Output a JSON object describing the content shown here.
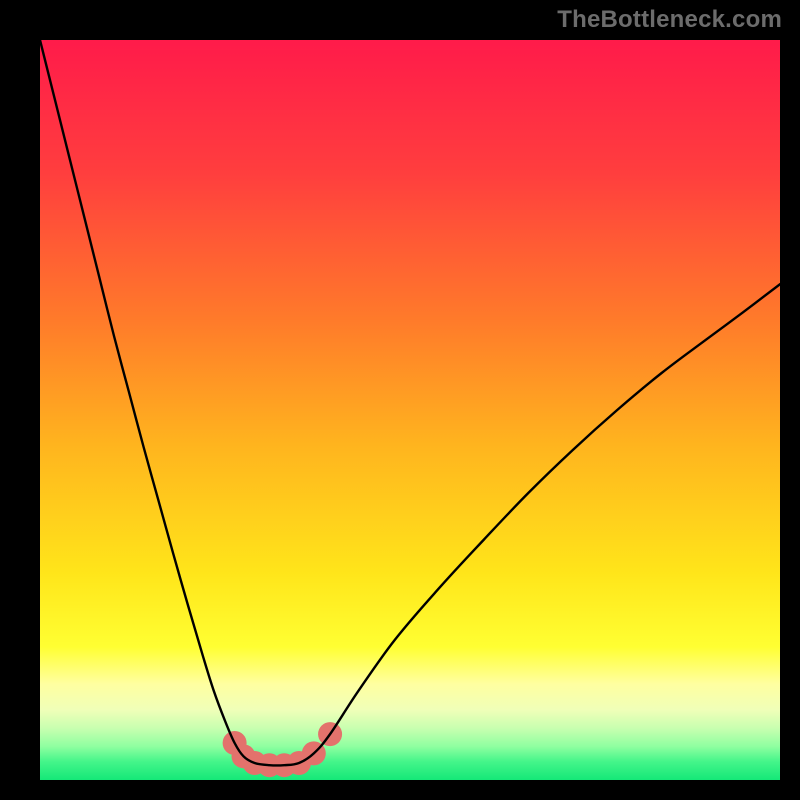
{
  "watermark": "TheBottleneck.com",
  "chart_data": {
    "type": "line",
    "title": "",
    "xlabel": "",
    "ylabel": "",
    "xlim": [
      0,
      100
    ],
    "ylim": [
      0,
      100
    ],
    "background_gradient_stops": [
      {
        "offset": 0.0,
        "color": "#ff1b4a"
      },
      {
        "offset": 0.18,
        "color": "#ff3e3e"
      },
      {
        "offset": 0.38,
        "color": "#ff7b2a"
      },
      {
        "offset": 0.55,
        "color": "#ffb51e"
      },
      {
        "offset": 0.72,
        "color": "#ffe51a"
      },
      {
        "offset": 0.82,
        "color": "#ffff32"
      },
      {
        "offset": 0.87,
        "color": "#ffffa0"
      },
      {
        "offset": 0.905,
        "color": "#f0ffb8"
      },
      {
        "offset": 0.93,
        "color": "#c8ffb0"
      },
      {
        "offset": 0.955,
        "color": "#8effa0"
      },
      {
        "offset": 0.975,
        "color": "#45f58a"
      },
      {
        "offset": 1.0,
        "color": "#14e878"
      }
    ],
    "series": [
      {
        "name": "bottleneck-curve",
        "x": [
          0,
          2,
          4,
          6,
          8,
          10,
          12,
          14,
          16,
          18,
          20,
          22,
          23.5,
          25,
          26.3,
          27.5,
          29,
          31,
          33,
          35,
          37,
          39.2,
          43,
          48,
          54,
          60,
          66,
          72,
          78,
          84,
          90,
          95,
          100
        ],
        "values": [
          100,
          92,
          84,
          76,
          68,
          60,
          52.5,
          45,
          37.8,
          30.6,
          23.6,
          16.8,
          12,
          8,
          5,
          3.2,
          2.3,
          2.0,
          2.0,
          2.3,
          3.6,
          6.2,
          12,
          19,
          26,
          32.5,
          38.8,
          44.6,
          50,
          55,
          59.5,
          63.2,
          67
        ]
      }
    ],
    "markers": {
      "name": "highlight-points",
      "color": "#e3726c",
      "radius": 12,
      "x": [
        26.3,
        27.5,
        29,
        31,
        33,
        35,
        37,
        39.2
      ],
      "values": [
        5.0,
        3.2,
        2.3,
        2.0,
        2.0,
        2.3,
        3.6,
        6.2
      ]
    }
  }
}
